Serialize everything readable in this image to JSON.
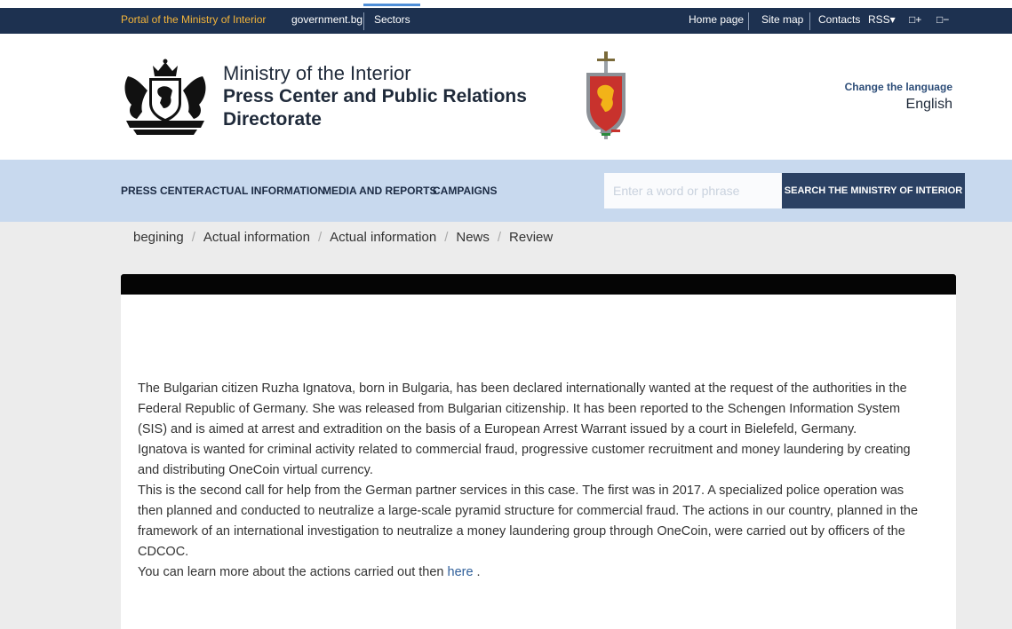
{
  "topbar": {
    "portal": "Portal of the Ministry of Interior",
    "gov": "government.bg",
    "sectors": "Sectors",
    "home": "Home page",
    "sitemap": "Site map",
    "contacts": "Contacts",
    "rss": "RSS▾",
    "font_plus": "□+",
    "font_minus": "□−"
  },
  "header": {
    "title_line1": "Ministry of the Interior",
    "title_line2a": "Press Center and Public Relations",
    "title_line2b": "Directorate",
    "lang_label": "Change the language",
    "lang_value": "English"
  },
  "nav": {
    "items": [
      "PRESS CENTER",
      "ACTUAL INFORMATION",
      "MEDIA AND REPORTS",
      "CAMPAIGNS"
    ],
    "search_placeholder": "Enter a word or phrase",
    "search_button": "SEARCH THE MINISTRY OF INTERIOR"
  },
  "breadcrumb": {
    "items": [
      "begining",
      "Actual information",
      "Actual information",
      "News",
      "Review"
    ],
    "divider": "/"
  },
  "article": {
    "p1": "The Bulgarian citizen Ruzha Ignatova, born in Bulgaria, has been declared internationally wanted at the request of the authorities in the Federal Republic of Germany. She was released from Bulgarian citizenship. It has been reported to the Schengen Information System (SIS) and is aimed at arrest and extradition on the basis of a European Arrest Warrant issued by a court in Bielefeld, Germany.",
    "p2": "Ignatova is wanted for criminal activity related to commercial fraud, progressive customer recruitment and money laundering by creating and distributing OneCoin virtual currency.",
    "p3": "This is the second call for help from the German partner services in this case. The first was in 2017. A specialized police operation was then planned and conducted to neutralize a large-scale pyramid structure for commercial fraud. The actions in our country, planned in the framework of an international investigation to neutralize a money laundering group through OneCoin, were carried out by officers of the CDCOC.",
    "p4_prefix": "You can learn more about the actions carried out then ",
    "p4_link": "here",
    "p4_suffix": " ."
  },
  "colors": {
    "topbar": "#1d3150",
    "portal_accent": "#f3b43a",
    "nav_bg": "#c8d9ee",
    "search_button": "#2b4163",
    "link": "#2f5f9a"
  },
  "icons": [
    "coat-of-arms-icon",
    "ministry-emblem-icon"
  ]
}
